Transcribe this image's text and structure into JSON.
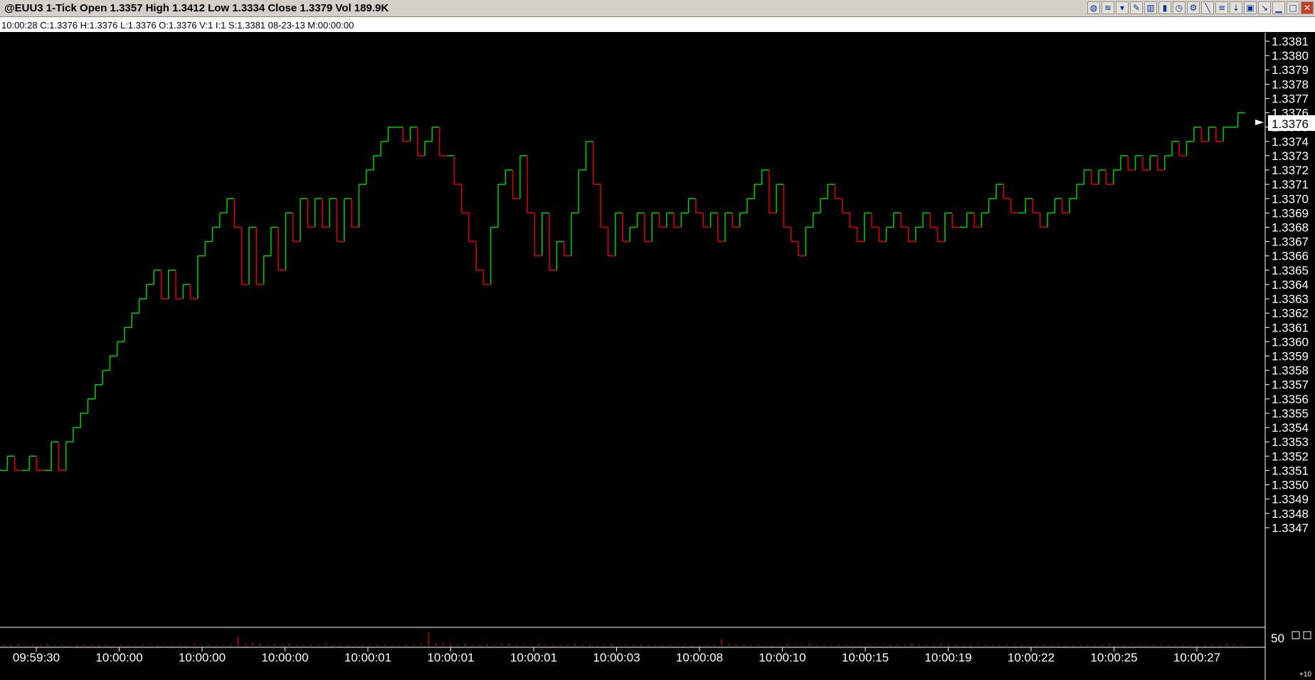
{
  "window": {
    "title": "@EUU3 1-Tick Open 1.3357 High 1.3412 Low 1.3334 Close 1.3379 Vol 189.9K",
    "toolbar_icons": [
      "world-icon",
      "stack-icon",
      "filter-icon",
      "draw-icon",
      "bar-chart-icon",
      "candle-icon",
      "clock-icon",
      "chart-settings-icon",
      "line-tool-icon",
      "fib-tool-icon",
      "arrow-down-icon",
      "trash-icon",
      "pin-icon",
      "minimize-icon",
      "maximize-icon",
      "close-icon"
    ]
  },
  "info_bar": {
    "text": "10:00:28  C:1.3376  H:1.3376  L:1.3376  O:1.3376  V:1  I:1  S:1.3381  08-23-13  M:00:00:00"
  },
  "colors": {
    "background": "#000000",
    "up": "#00d000",
    "down": "#e00000",
    "neutral": "#c8c800",
    "axis": "#ffffff",
    "volume": "#e00000"
  },
  "chart_data": {
    "type": "line",
    "title": "@EUU3 1-Tick",
    "ylim": [
      1.3346,
      1.3381
    ],
    "price_ticks": [
      "1.3381",
      "1.3380",
      "1.3379",
      "1.3378",
      "1.3377",
      "1.3376",
      "1.3375",
      "1.3374",
      "1.3373",
      "1.3372",
      "1.3371",
      "1.3370",
      "1.3369",
      "1.3368",
      "1.3367",
      "1.3366",
      "1.3365",
      "1.3364",
      "1.3363",
      "1.3362",
      "1.3361",
      "1.3360",
      "1.3359",
      "1.3358",
      "1.3357",
      "1.3356",
      "1.3355",
      "1.3354",
      "1.3353",
      "1.3352",
      "1.3351",
      "1.3350",
      "1.3349",
      "1.3348",
      "1.3347"
    ],
    "current_price": "1.3376",
    "x_tick_labels": [
      "09:59:30",
      "10:00:00",
      "10:00:00",
      "10:00:00",
      "10:00:01",
      "10:00:01",
      "10:00:01",
      "10:00:03",
      "10:00:08",
      "10:00:10",
      "10:00:15",
      "10:00:19",
      "10:00:22",
      "10:00:25",
      "10:00:27"
    ],
    "series": [
      {
        "values": [
          1.3351,
          1.3352,
          1.3351,
          1.3351,
          1.3352,
          1.3351,
          1.3351,
          1.3353,
          1.3351,
          1.3353,
          1.3354,
          1.3355,
          1.3356,
          1.3357,
          1.3358,
          1.3359,
          1.336,
          1.3361,
          1.3362,
          1.3363,
          1.3364,
          1.3365,
          1.3363,
          1.3365,
          1.3363,
          1.3364,
          1.3363,
          1.3366,
          1.3367,
          1.3368,
          1.3369,
          1.337,
          1.3368,
          1.3364,
          1.3368,
          1.3364,
          1.3366,
          1.3368,
          1.3365,
          1.3369,
          1.3367,
          1.337,
          1.3368,
          1.337,
          1.3368,
          1.337,
          1.3367,
          1.337,
          1.3368,
          1.3371,
          1.3372,
          1.3373,
          1.3374,
          1.3375,
          1.3375,
          1.3374,
          1.3375,
          1.3373,
          1.3374,
          1.3375,
          1.3373,
          1.3373,
          1.3371,
          1.3369,
          1.3367,
          1.3365,
          1.3364,
          1.3368,
          1.3371,
          1.3372,
          1.337,
          1.3373,
          1.3369,
          1.3366,
          1.3369,
          1.3365,
          1.3367,
          1.3366,
          1.3369,
          1.3372,
          1.3374,
          1.3371,
          1.3368,
          1.3366,
          1.3369,
          1.3367,
          1.3368,
          1.3369,
          1.3367,
          1.3369,
          1.3368,
          1.3369,
          1.3368,
          1.3369,
          1.337,
          1.3369,
          1.3368,
          1.3369,
          1.3367,
          1.3369,
          1.3368,
          1.3369,
          1.337,
          1.3371,
          1.3372,
          1.3369,
          1.3371,
          1.3368,
          1.3367,
          1.3366,
          1.3368,
          1.3369,
          1.337,
          1.3371,
          1.337,
          1.3369,
          1.3368,
          1.3367,
          1.3369,
          1.3368,
          1.3367,
          1.3368,
          1.3369,
          1.3368,
          1.3367,
          1.3368,
          1.3369,
          1.3368,
          1.3367,
          1.3369,
          1.3368,
          1.3368,
          1.3369,
          1.3368,
          1.3369,
          1.337,
          1.3371,
          1.337,
          1.3369,
          1.3369,
          1.337,
          1.3369,
          1.3368,
          1.3369,
          1.337,
          1.3369,
          1.337,
          1.3371,
          1.3372,
          1.3371,
          1.3372,
          1.3371,
          1.3372,
          1.3373,
          1.3372,
          1.3373,
          1.3372,
          1.3373,
          1.3372,
          1.3373,
          1.3374,
          1.3373,
          1.3374,
          1.3375,
          1.3374,
          1.3375,
          1.3374,
          1.3375,
          1.3375,
          1.3376
        ],
        "volume": [
          1,
          1,
          2,
          1,
          1,
          1,
          2,
          1,
          1,
          1,
          1,
          1,
          1,
          1,
          1,
          1,
          1,
          1,
          1,
          1,
          1,
          1,
          1,
          1,
          1,
          1,
          2,
          1,
          1,
          1,
          1,
          1,
          8,
          2,
          3,
          2,
          1,
          2,
          1,
          2,
          1,
          1,
          1,
          1,
          2,
          1,
          1,
          1,
          1,
          1,
          1,
          1,
          1,
          1,
          1,
          1,
          1,
          2,
          12,
          2,
          3,
          2,
          1,
          2,
          1,
          1,
          2,
          1,
          2,
          2,
          1,
          1,
          1,
          2,
          1,
          1,
          1,
          1,
          2,
          1,
          1,
          1,
          1,
          2,
          1,
          1,
          1,
          1,
          1,
          1,
          1,
          1,
          1,
          1,
          1,
          1,
          1,
          1,
          6,
          2,
          1,
          1,
          1,
          1,
          1,
          1,
          1,
          2,
          1,
          1,
          2,
          1,
          1,
          1,
          1,
          1,
          1,
          1,
          1,
          1,
          1,
          1,
          1,
          1,
          2,
          1,
          1,
          1,
          2,
          1,
          1,
          1,
          1,
          1,
          1,
          1,
          1,
          1,
          1,
          1,
          1,
          1,
          1,
          1,
          1,
          1,
          1,
          1,
          1,
          1,
          1,
          2,
          1,
          1,
          1,
          1,
          1,
          1,
          1,
          1,
          1,
          1,
          1,
          1,
          1,
          1,
          1,
          2,
          1,
          1,
          1,
          1,
          1,
          1
        ]
      }
    ],
    "volume_axis_label": "50",
    "volume_scale_note": "+10"
  }
}
